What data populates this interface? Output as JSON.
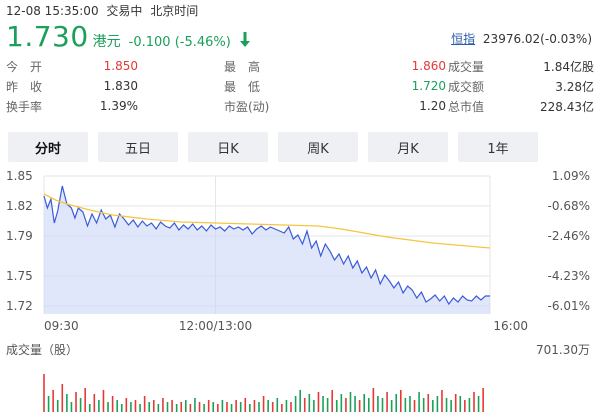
{
  "header": {
    "datetime": "12-08 15:35:00",
    "trade_status": "交易中",
    "timezone": "北京时间"
  },
  "quote": {
    "price": "1.730",
    "currency": "港元",
    "change": "-0.100 (-5.46%)",
    "direction_icon": "arrow-down-icon",
    "color_down": "#1aa05a"
  },
  "index": {
    "name": "恒指",
    "value": "23976.02(-0.03%)"
  },
  "stats": [
    [
      {
        "label": "今　开",
        "value": "1.850",
        "tone": "red"
      },
      {
        "label": "最　高",
        "value": "1.860",
        "tone": "red"
      },
      {
        "label": "成交量",
        "value": "1.84亿股",
        "tone": ""
      }
    ],
    [
      {
        "label": "昨　收",
        "value": "1.830",
        "tone": ""
      },
      {
        "label": "最　低",
        "value": "1.720",
        "tone": "green"
      },
      {
        "label": "成交额",
        "value": "3.28亿",
        "tone": ""
      }
    ],
    [
      {
        "label": "换手率",
        "value": "1.39%",
        "tone": ""
      },
      {
        "label": "市盈(动)",
        "value": "1.20",
        "tone": ""
      },
      {
        "label": "总市值",
        "value": "228.43亿",
        "tone": ""
      }
    ]
  ],
  "tabs": [
    {
      "label": "分时",
      "active": true
    },
    {
      "label": "五日",
      "active": false
    },
    {
      "label": "日K",
      "active": false
    },
    {
      "label": "周K",
      "active": false
    },
    {
      "label": "月K",
      "active": false
    },
    {
      "label": "1年",
      "active": false
    }
  ],
  "chart_data": {
    "type": "line",
    "y_left_ticks": [
      "1.85",
      "1.82",
      "1.79",
      "1.75",
      "1.72"
    ],
    "y_right_ticks": [
      "1.09%",
      "-0.68%",
      "-2.46%",
      "-4.23%",
      "-6.01%"
    ],
    "ylim": [
      1.712,
      1.85
    ],
    "x_ticks": [
      "09:30",
      "12:00/13:00",
      "16:00"
    ],
    "x_domain_minutes": [
      0,
      390
    ],
    "grid": true,
    "series": [
      {
        "role": "price",
        "x": [
          0,
          3,
          6,
          9,
          12,
          16,
          20,
          24,
          27,
          30,
          34,
          38,
          42,
          46,
          50,
          54,
          58,
          62,
          66,
          70,
          74,
          78,
          82,
          86,
          90,
          94,
          98,
          102,
          106,
          110,
          114,
          118,
          122,
          126,
          130,
          134,
          138,
          142,
          146,
          150,
          154,
          158,
          162,
          166,
          170,
          174,
          178,
          182,
          186,
          190,
          194,
          198,
          202,
          206,
          210,
          214,
          218,
          222,
          226,
          230,
          234,
          238,
          242,
          246,
          250,
          254,
          258,
          262,
          266,
          270,
          274,
          278,
          282,
          286,
          290,
          294,
          298,
          302,
          306,
          310,
          314,
          318,
          322,
          326,
          330,
          334,
          338,
          342,
          346,
          350,
          354,
          358,
          362,
          366,
          370,
          374,
          378,
          382,
          386,
          390
        ],
        "y": [
          1.83,
          1.818,
          1.827,
          1.803,
          1.815,
          1.84,
          1.822,
          1.818,
          1.808,
          1.818,
          1.814,
          1.8,
          1.812,
          1.803,
          1.816,
          1.807,
          1.811,
          1.799,
          1.812,
          1.807,
          1.801,
          1.806,
          1.799,
          1.805,
          1.8,
          1.803,
          1.797,
          1.804,
          1.8,
          1.798,
          1.803,
          1.796,
          1.801,
          1.797,
          1.802,
          1.796,
          1.8,
          1.795,
          1.801,
          1.797,
          1.799,
          1.795,
          1.8,
          1.797,
          1.799,
          1.796,
          1.799,
          1.792,
          1.797,
          1.8,
          1.796,
          1.799,
          1.797,
          1.795,
          1.793,
          1.799,
          1.787,
          1.791,
          1.782,
          1.795,
          1.778,
          1.785,
          1.77,
          1.782,
          1.775,
          1.766,
          1.772,
          1.762,
          1.77,
          1.758,
          1.765,
          1.753,
          1.759,
          1.748,
          1.756,
          1.742,
          1.751,
          1.745,
          1.738,
          1.744,
          1.733,
          1.74,
          1.736,
          1.728,
          1.734,
          1.724,
          1.727,
          1.731,
          1.725,
          1.73,
          1.722,
          1.728,
          1.724,
          1.73,
          1.726,
          1.725,
          1.73,
          1.726,
          1.73,
          1.73
        ]
      },
      {
        "role": "average",
        "x": [
          0,
          10,
          20,
          40,
          60,
          90,
          120,
          150,
          180,
          210,
          240,
          260,
          280,
          300,
          320,
          340,
          360,
          380,
          390
        ],
        "y": [
          1.832,
          1.826,
          1.822,
          1.816,
          1.811,
          1.807,
          1.804,
          1.803,
          1.802,
          1.801,
          1.8,
          1.797,
          1.793,
          1.789,
          1.786,
          1.783,
          1.781,
          1.779,
          1.778
        ]
      }
    ],
    "volume_label": "成交量（股）",
    "volume_max": "701.30万",
    "volume": {
      "x": [
        0,
        4,
        8,
        12,
        16,
        20,
        24,
        28,
        32,
        36,
        40,
        44,
        48,
        52,
        56,
        60,
        64,
        68,
        72,
        76,
        80,
        84,
        88,
        92,
        96,
        100,
        104,
        108,
        112,
        116,
        120,
        124,
        128,
        132,
        136,
        140,
        144,
        148,
        152,
        156,
        160,
        164,
        168,
        172,
        176,
        180,
        184,
        188,
        192,
        196,
        200,
        204,
        208,
        212,
        216,
        220,
        224,
        228,
        232,
        236,
        240,
        244,
        248,
        252,
        256,
        260,
        264,
        268,
        272,
        276,
        280,
        284,
        288,
        292,
        296,
        300,
        304,
        308,
        312,
        316,
        320,
        324,
        328,
        332,
        336,
        340,
        344,
        348,
        352,
        356,
        360,
        364,
        368,
        372,
        376,
        380,
        384
      ],
      "v": [
        0.95,
        0.4,
        0.55,
        0.3,
        0.7,
        0.45,
        0.25,
        0.5,
        0.35,
        0.6,
        0.2,
        0.45,
        0.3,
        0.55,
        0.25,
        0.4,
        0.3,
        0.2,
        0.35,
        0.25,
        0.3,
        0.2,
        0.4,
        0.25,
        0.3,
        0.2,
        0.35,
        0.25,
        0.3,
        0.2,
        0.25,
        0.3,
        0.2,
        0.35,
        0.25,
        0.2,
        0.3,
        0.25,
        0.2,
        0.3,
        0.25,
        0.2,
        0.3,
        0.25,
        0.35,
        0.2,
        0.3,
        0.25,
        0.4,
        0.3,
        0.25,
        0.35,
        0.2,
        0.3,
        0.25,
        0.4,
        0.55,
        0.35,
        0.45,
        0.3,
        0.5,
        0.4,
        0.35,
        0.55,
        0.3,
        0.45,
        0.35,
        0.5,
        0.4,
        0.3,
        0.45,
        0.35,
        0.6,
        0.4,
        0.35,
        0.5,
        0.3,
        0.45,
        0.55,
        0.35,
        0.4,
        0.3,
        0.5,
        0.35,
        0.45,
        0.3,
        0.4,
        0.55,
        0.35,
        0.3,
        0.45,
        0.4,
        0.3,
        0.35,
        0.5,
        0.4,
        0.6
      ],
      "up": [
        true,
        false,
        true,
        false,
        true,
        false,
        false,
        true,
        false,
        true,
        false,
        true,
        false,
        true,
        false,
        true,
        false,
        false,
        true,
        false,
        true,
        false,
        true,
        false,
        true,
        false,
        true,
        false,
        true,
        false,
        true,
        false,
        true,
        false,
        true,
        false,
        true,
        false,
        true,
        false,
        true,
        false,
        true,
        false,
        true,
        false,
        true,
        false,
        true,
        false,
        true,
        false,
        true,
        false,
        true,
        false,
        false,
        true,
        false,
        false,
        true,
        false,
        false,
        true,
        false,
        false,
        true,
        false,
        false,
        true,
        false,
        false,
        true,
        false,
        false,
        true,
        false,
        false,
        true,
        false,
        false,
        true,
        false,
        false,
        true,
        false,
        false,
        true,
        false,
        false,
        true,
        false,
        true,
        false,
        true,
        false,
        true
      ]
    },
    "colors": {
      "price_line": "#3b5bd9",
      "price_fill": "#c8d3f7",
      "average_line": "#f5c542",
      "grid": "#e6e6e6",
      "vol_up": "#e53935",
      "vol_down": "#1aa05a",
      "axis_text": "#555555"
    }
  }
}
